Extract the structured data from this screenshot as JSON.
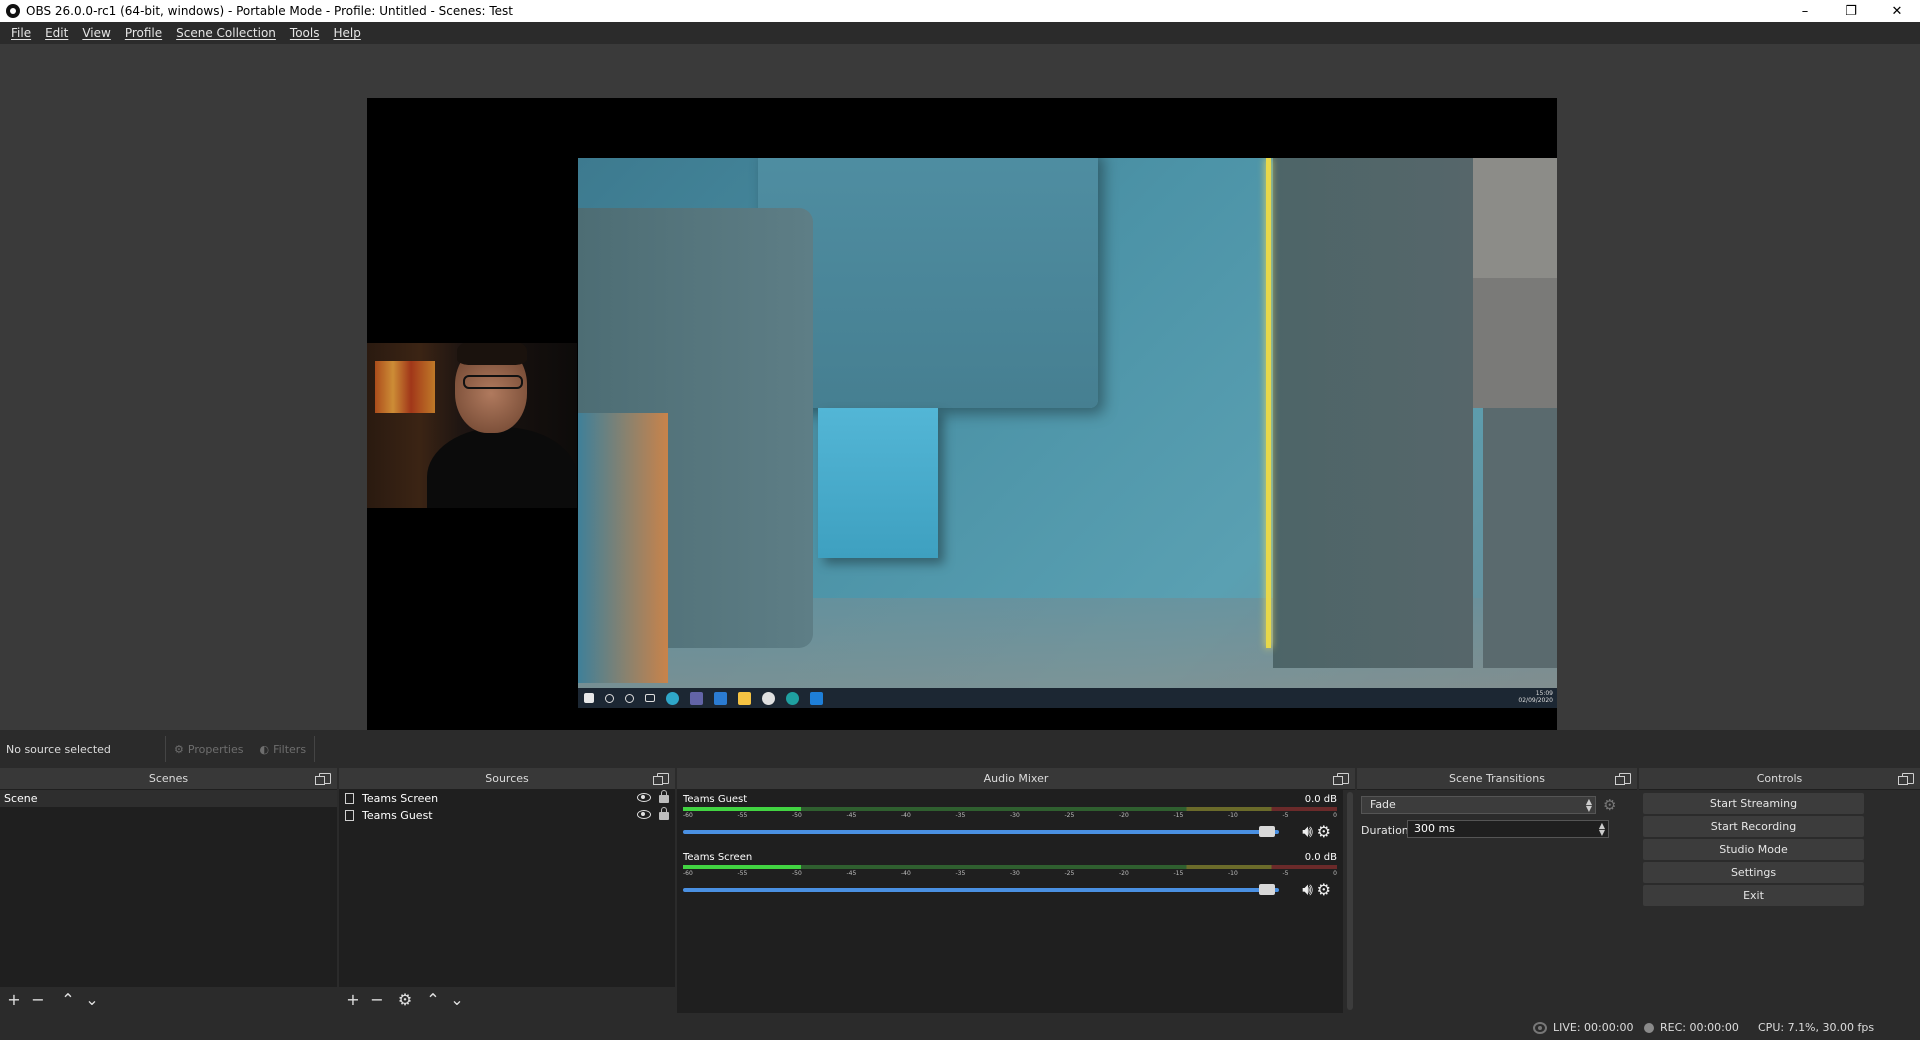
{
  "window": {
    "title": "OBS 26.0.0-rc1 (64-bit, windows) - Portable Mode - Profile: Untitled - Scenes: Test",
    "minimize": "–",
    "restore": "❐",
    "close": "✕"
  },
  "menu": {
    "items": [
      "File",
      "Edit",
      "View",
      "Profile",
      "Scene Collection",
      "Tools",
      "Help"
    ]
  },
  "preview": {
    "taskbar_time": "15:09",
    "taskbar_date": "02/09/2020"
  },
  "source_toolbar": {
    "status": "No source selected",
    "properties_label": "Properties",
    "filters_label": "Filters"
  },
  "scenes": {
    "title": "Scenes",
    "items": [
      "Scene"
    ]
  },
  "sources": {
    "title": "Sources",
    "items": [
      "Teams Screen",
      "Teams Guest"
    ]
  },
  "mixer": {
    "title": "Audio Mixer",
    "channels": [
      {
        "name": "Teams Guest",
        "db": "0.0 dB",
        "level": 0.18
      },
      {
        "name": "Teams Screen",
        "db": "0.0 dB",
        "level": 0.18
      }
    ],
    "ticks": [
      "-60",
      "-55",
      "-50",
      "-45",
      "-40",
      "-35",
      "-30",
      "-25",
      "-20",
      "-15",
      "-10",
      "-5",
      "0"
    ]
  },
  "transitions": {
    "title": "Scene Transitions",
    "selected": "Fade",
    "duration_label": "Duration",
    "duration_value": "300 ms"
  },
  "controls": {
    "title": "Controls",
    "start_streaming": "Start Streaming",
    "start_recording": "Start Recording",
    "studio_mode": "Studio Mode",
    "settings": "Settings",
    "exit": "Exit"
  },
  "status": {
    "live": "LIVE: 00:00:00",
    "rec": "REC: 00:00:00",
    "cpu": "CPU: 7.1%, 30.00 fps"
  },
  "colors": {
    "background": "#2b2b2b",
    "dock_body": "#1f1f1f",
    "slider": "#4a90e2",
    "meter_green": "#42d442"
  }
}
